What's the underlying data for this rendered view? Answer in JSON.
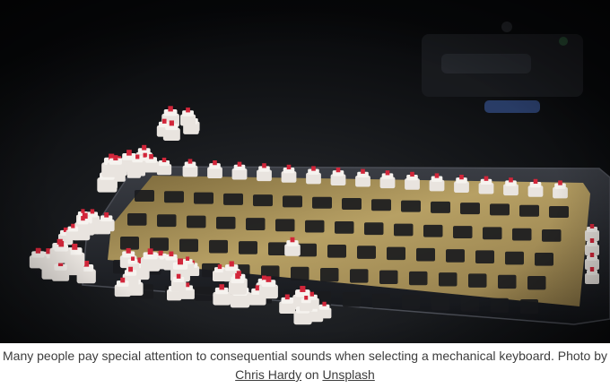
{
  "image": {
    "alt": "Mechanical keyboard plate with red-stem switches, loose switches scattered on a dark desk"
  },
  "caption": {
    "text": "Many people pay special attention to consequential sounds when selecting a mechanical keyboard. Photo by",
    "author_link": "Chris Hardy",
    "connector": "on",
    "source_link": "Unsplash"
  },
  "colors": {
    "background": "#0b0c0e",
    "plate_gold": "#b29a5e",
    "switch_housing": "#e9e4df",
    "switch_stem": "#d2263a",
    "caption_text": "#3c3c3c"
  }
}
